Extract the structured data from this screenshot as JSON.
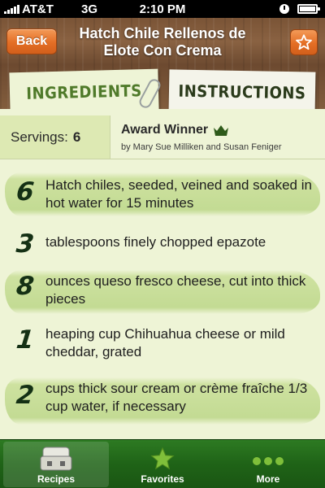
{
  "status_bar": {
    "carrier": "AT&T",
    "network": "3G",
    "time": "2:10 PM"
  },
  "header": {
    "back_label": "Back",
    "title_line1": "Hatch Chile Rellenos de",
    "title_line2": "Elote Con Crema",
    "favorite_icon": "star-icon",
    "button_color": "#e46e25"
  },
  "tabs": {
    "ingredients_label": "INGREDIENTS",
    "instructions_label": "INSTRUCTIONS",
    "active": "ingredients"
  },
  "info": {
    "servings_label": "Servings:",
    "servings_value": "6",
    "award_title": "Award Winner",
    "award_icon": "crown-icon",
    "author": "by Mary Sue Milliken and Susan Feniger"
  },
  "ingredients": [
    {
      "qty": "6",
      "text": "Hatch chiles, seeded, veined and soaked in hot water for 15 minutes",
      "highlighted": true
    },
    {
      "qty": "3",
      "text": "tablespoons finely chopped epazote",
      "highlighted": false
    },
    {
      "qty": "8",
      "text": "ounces queso fresco cheese, cut into thick pieces",
      "highlighted": true
    },
    {
      "qty": "1",
      "text": "heaping cup Chihuahua cheese or mild cheddar, grated",
      "highlighted": false
    },
    {
      "qty": "2",
      "text": "cups thick sour cream or crème fraîche 1/3 cup water, if necessary",
      "highlighted": true
    }
  ],
  "tabbar": {
    "recipes_label": "Recipes",
    "favorites_label": "Favorites",
    "more_label": "More",
    "active": "recipes"
  },
  "colors": {
    "accent_green": "#4f7a2a",
    "paper": "#eef4d6",
    "tabbar_green": "#1f6317"
  }
}
